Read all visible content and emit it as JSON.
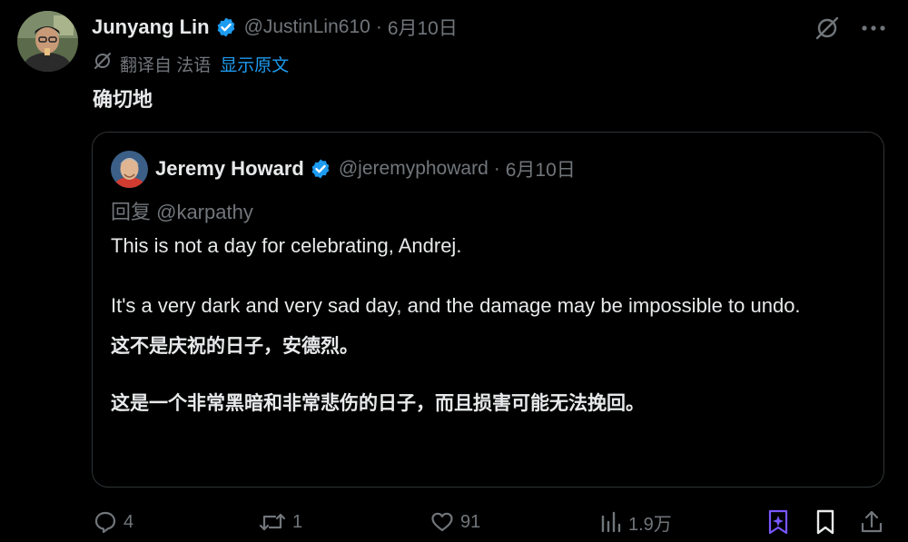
{
  "tweet": {
    "author": {
      "display_name": "Junyang Lin",
      "handle": "@JustinLin610",
      "verified": true,
      "date": "6月10日"
    },
    "translation": {
      "translated_from": "翻译自 法语",
      "show_original": "显示原文"
    },
    "text": "确切地",
    "quoted": {
      "author": {
        "display_name": "Jeremy Howard",
        "handle": "@jeremyphoward",
        "verified": true,
        "date": "6月10日"
      },
      "reply_to": "回复 @karpathy",
      "paragraph_1": "This is not a day for celebrating, Andrej.",
      "paragraph_2": "It's a very dark and very sad day, and the damage may be impossible to undo.",
      "translation_1": "这不是庆祝的日子，安德烈。",
      "translation_2": "这是一个非常黑暗和非常悲伤的日子，而且损害可能无法挽回。"
    },
    "separator": "·",
    "actions": {
      "replies": "4",
      "reposts": "1",
      "likes": "91",
      "views": "1.9万"
    }
  },
  "colors": {
    "background": "#000000",
    "text": "#e7e9ea",
    "muted": "#71767b",
    "link": "#1d9bf0",
    "verified": "#1d9bf0",
    "grok_icon": "#7856ff",
    "border": "#2f3336"
  }
}
